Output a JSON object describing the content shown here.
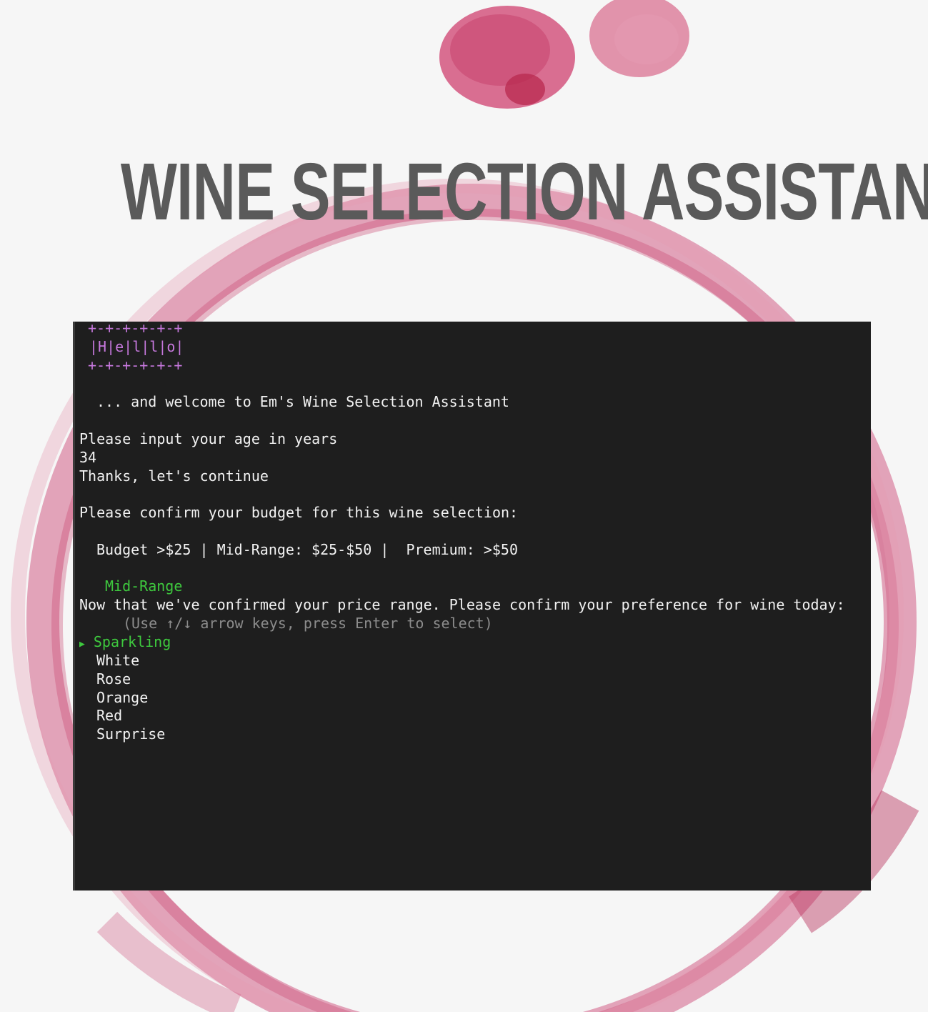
{
  "page": {
    "title": "WINE SELECTION ASSISTANT"
  },
  "colors": {
    "title": "#5a5a5a",
    "terminal_bg": "#1e1e1e",
    "banner": "#c678dd",
    "accent": "#3ec93e",
    "hint": "#8c8c8c",
    "stain": "#c24a73"
  },
  "terminal": {
    "banner": {
      "border_top": "+-+-+-+-+-+",
      "word": "|H|e|l|l|o|",
      "border_bottom": "+-+-+-+-+-+"
    },
    "welcome": "... and welcome to Em's Wine Selection Assistant",
    "age_prompt": "Please input your age in years",
    "age_value": "34",
    "age_ack": "Thanks, let's continue",
    "budget_prompt": "Please confirm your budget for this wine selection:",
    "budget_options": "Budget >$25 | Mid-Range: $25-$50 |  Premium: >$50",
    "budget_selected": "Mid-Range",
    "preference_prompt": "Now that we've confirmed your price range. Please confirm your preference for wine today:",
    "hint": "(Use ↑/↓ arrow keys, press Enter to select)",
    "cursor_icon": "triangle-right-icon",
    "options": [
      "Sparkling",
      "White",
      "Rose",
      "Orange",
      "Red",
      "Surprise"
    ],
    "selected_option": "Sparkling"
  }
}
